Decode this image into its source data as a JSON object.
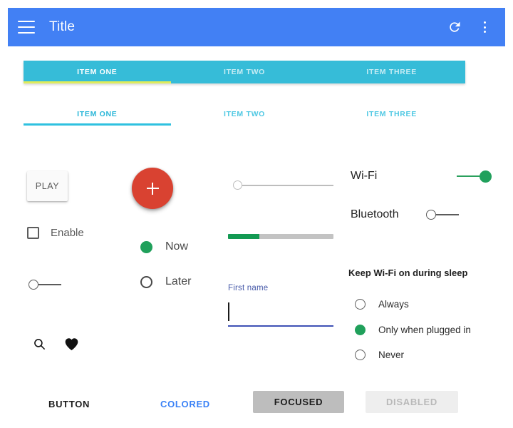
{
  "appbar": {
    "title": "Title",
    "menu_icon": "hamburger-menu-icon",
    "refresh_icon": "refresh-icon",
    "overflow_icon": "more-vert-icon",
    "background": "#4280f4"
  },
  "tabs_filled": {
    "background": "#36bcd8",
    "indicator_color": "#e0ec5a",
    "active_index": 0,
    "items": [
      {
        "label": "ITEM ONE"
      },
      {
        "label": "ITEM TWO"
      },
      {
        "label": "ITEM THREE"
      }
    ]
  },
  "tabs_plain": {
    "indicator_color": "#2fc1e0",
    "active_index": 0,
    "items": [
      {
        "label": "ITEM ONE"
      },
      {
        "label": "ITEM TWO"
      },
      {
        "label": "ITEM THREE"
      }
    ]
  },
  "left_column": {
    "play_button": "PLAY",
    "checkbox": {
      "label": "Enable",
      "checked": false
    },
    "switch": {
      "checked": false
    },
    "icons": [
      {
        "name": "search-icon"
      },
      {
        "name": "favorite-heart-icon"
      }
    ]
  },
  "middle_column": {
    "fab": {
      "icon": "plus-icon",
      "color": "#d94231"
    },
    "radio_group": {
      "selected": "Now",
      "options": [
        {
          "label": "Now",
          "selected": true
        },
        {
          "label": "Later",
          "selected": false
        }
      ]
    },
    "slider": {
      "value": 0,
      "min": 0,
      "max": 100
    },
    "progress": {
      "value": 30,
      "max": 100,
      "color": "#139a53"
    },
    "textfield": {
      "label": "First name",
      "value": "",
      "placeholder": "",
      "accent": "#3f51b5"
    }
  },
  "right_column": {
    "switches": [
      {
        "label": "Wi-Fi",
        "checked": true
      },
      {
        "label": "Bluetooth",
        "checked": false
      }
    ],
    "section_title": "Keep Wi-Fi on during sleep",
    "radio_group": {
      "selected": "Only when plugged in",
      "options": [
        {
          "label": "Always",
          "selected": false
        },
        {
          "label": "Only when plugged in",
          "selected": true
        },
        {
          "label": "Never",
          "selected": false
        }
      ]
    }
  },
  "bottom_buttons": [
    {
      "label": "BUTTON",
      "state": "normal"
    },
    {
      "label": "COLORED",
      "state": "colored"
    },
    {
      "label": "FOCUSED",
      "state": "focused"
    },
    {
      "label": "DISABLED",
      "state": "disabled"
    }
  ]
}
